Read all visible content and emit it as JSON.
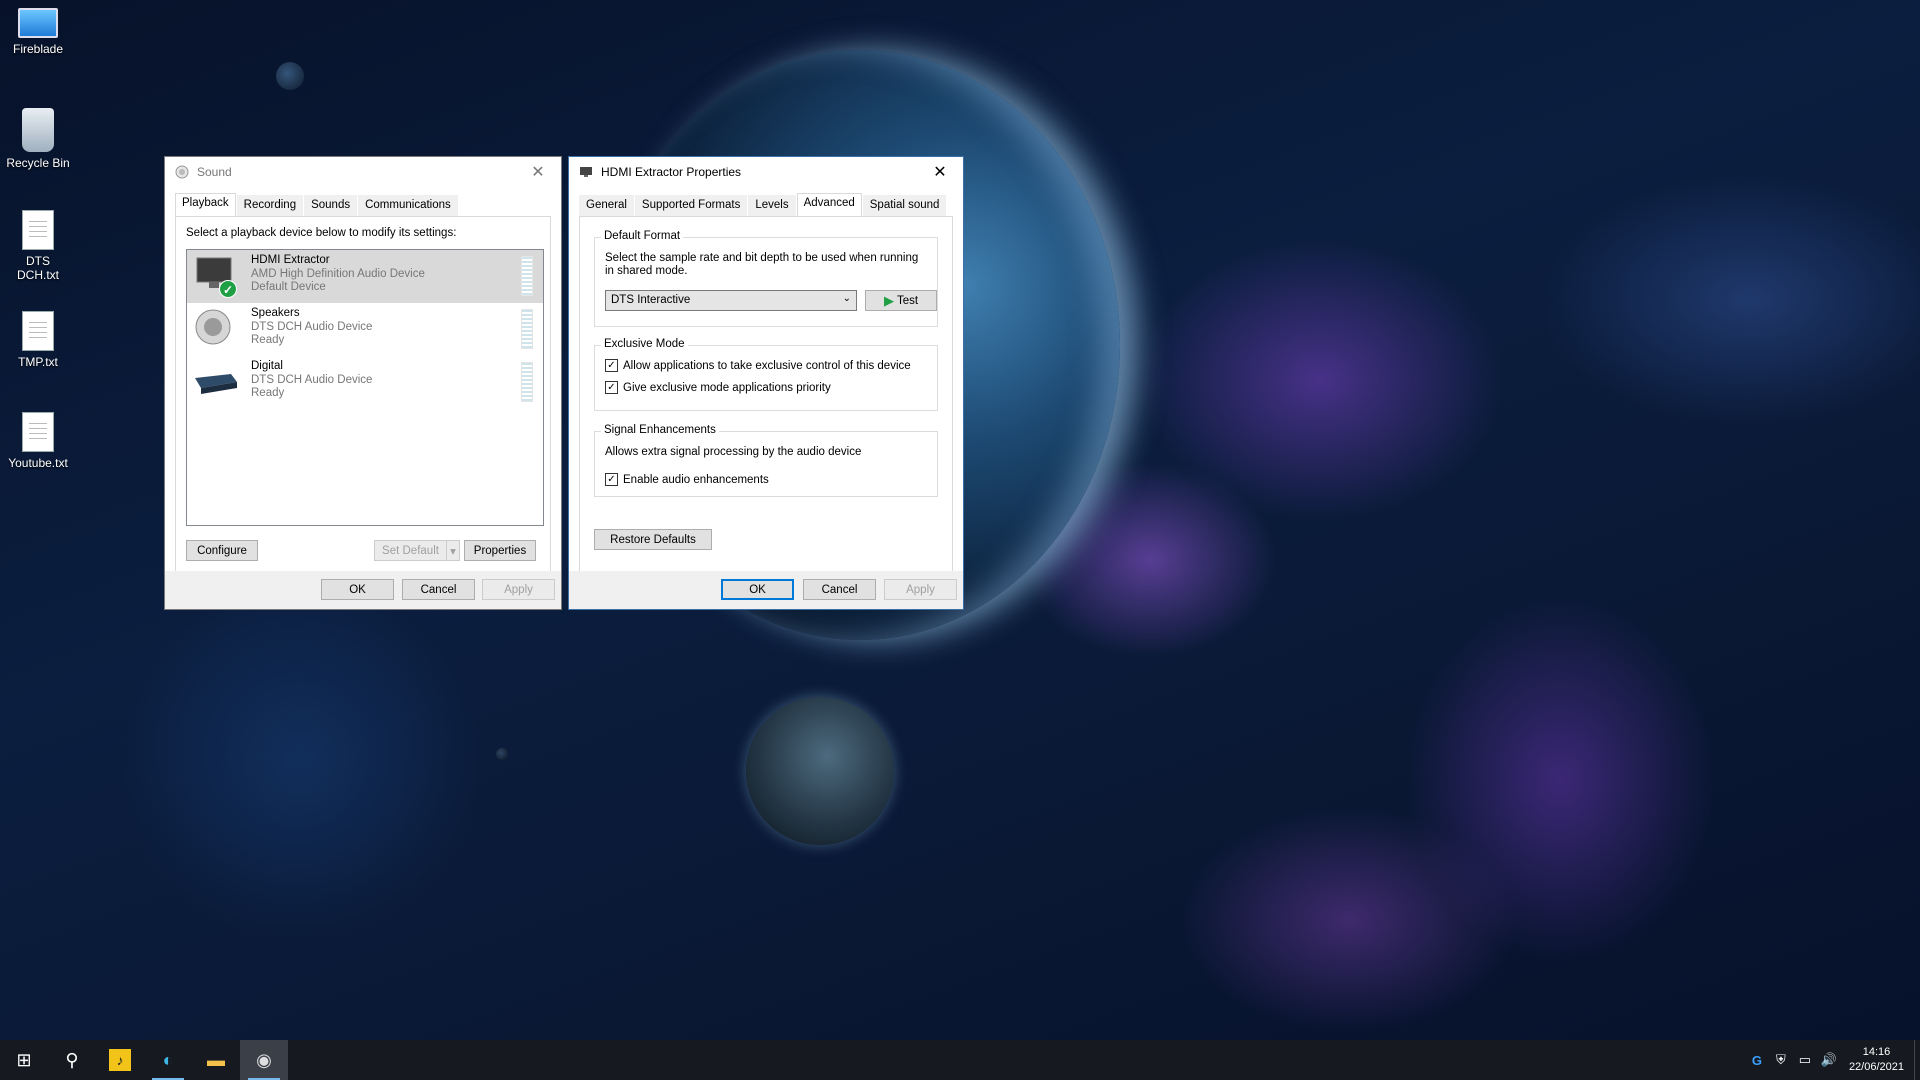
{
  "desktop": {
    "icons": [
      {
        "label": "Fireblade",
        "icon": "computer-icon"
      },
      {
        "label": "Recycle Bin",
        "icon": "recycle-bin-icon"
      },
      {
        "label": "DTS DCH.txt",
        "icon": "text-file-icon"
      },
      {
        "label": "TMP.txt",
        "icon": "text-file-icon"
      },
      {
        "label": "Youtube.txt",
        "icon": "text-file-icon"
      }
    ]
  },
  "sound_window": {
    "title": "Sound",
    "close": "✕",
    "tabs": [
      "Playback",
      "Recording",
      "Sounds",
      "Communications"
    ],
    "active_tab": "Playback",
    "instruction": "Select a playback device below to modify its settings:",
    "devices": [
      {
        "name": "HDMI Extractor",
        "driver": "AMD High Definition Audio Device",
        "status": "Default Device",
        "selected": true,
        "badge": "✓"
      },
      {
        "name": "Speakers",
        "driver": "DTS DCH Audio Device",
        "status": "Ready",
        "selected": false
      },
      {
        "name": "Digital",
        "driver": "DTS DCH Audio Device",
        "status": "Ready",
        "selected": false
      }
    ],
    "buttons": {
      "configure": "Configure",
      "set_default": "Set Default",
      "set_default_arrow": "▾",
      "properties": "Properties",
      "ok": "OK",
      "cancel": "Cancel",
      "apply": "Apply"
    }
  },
  "props_window": {
    "title": "HDMI Extractor Properties",
    "close": "✕",
    "tabs": [
      "General",
      "Supported Formats",
      "Levels",
      "Advanced",
      "Spatial sound"
    ],
    "active_tab": "Advanced",
    "default_format": {
      "title": "Default Format",
      "description": "Select the sample rate and bit depth to be used when running in shared mode.",
      "selected": "DTS Interactive",
      "arrow": "⌄",
      "test_icon": "▶",
      "test_label": "Test"
    },
    "exclusive_mode": {
      "title": "Exclusive Mode",
      "options": [
        {
          "label": "Allow applications to take exclusive control of this device",
          "checked": true
        },
        {
          "label": "Give exclusive mode applications priority",
          "checked": true
        }
      ]
    },
    "signal_enhancements": {
      "title": "Signal Enhancements",
      "description": "Allows extra signal processing by the audio device",
      "option": {
        "label": "Enable audio enhancements",
        "checked": true
      }
    },
    "check_mark": "✓",
    "buttons": {
      "restore": "Restore Defaults",
      "ok": "OK",
      "cancel": "Cancel",
      "apply": "Apply"
    }
  },
  "taskbar": {
    "start_glyph": "⊞",
    "search_glyph": "⚲",
    "apps": [
      {
        "name": "player",
        "glyph": "♪"
      },
      {
        "name": "edge",
        "glyph": "◐"
      },
      {
        "name": "file-explorer",
        "glyph": "▬"
      },
      {
        "name": "sound",
        "glyph": "◉"
      }
    ],
    "tray_glyphs": {
      "app": "G",
      "security": "⛨",
      "network": "▭",
      "volume": "🔊"
    },
    "time": "14:16",
    "date": "22/06/2021"
  },
  "colors": {
    "accent": "#0078d7",
    "selected_row": "#d9d9d9",
    "check_green": "#1fa045",
    "taskbar": "#16191f"
  }
}
